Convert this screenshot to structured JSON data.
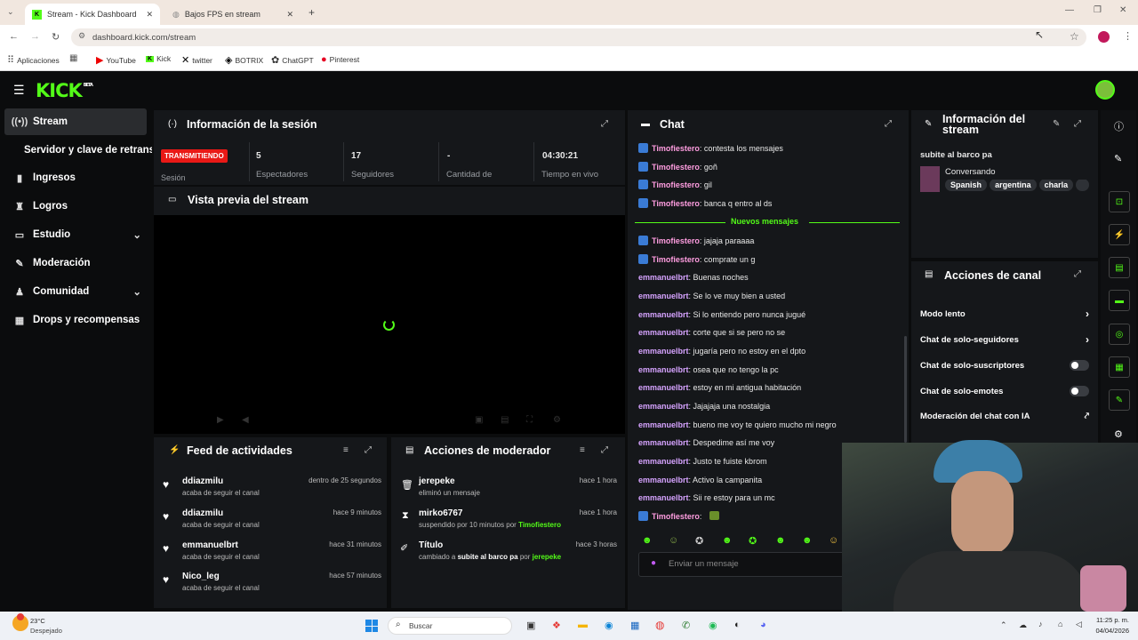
{
  "browser": {
    "tabs": [
      {
        "title": "Stream - Kick Dashboard"
      },
      {
        "title": "Bajos FPS en stream"
      }
    ],
    "url": "dashboard.kick.com/stream",
    "bookmarks": [
      "Aplicaciones",
      "YouTube",
      "Kick",
      "twitter",
      "BOTRIX",
      "ChatGPT",
      "Pinterest"
    ]
  },
  "brand": {
    "logo": "KICK",
    "beta": "BETA",
    "accent": "#53fc18"
  },
  "sidebar": {
    "items": [
      {
        "label": "Stream",
        "icon": "broadcast-icon"
      },
      {
        "label": "Servidor y clave de retransmisión",
        "icon": ""
      },
      {
        "label": "Ingresos",
        "icon": "chart-icon"
      },
      {
        "label": "Logros",
        "icon": "trophy-icon"
      },
      {
        "label": "Estudio",
        "icon": "monitor-icon"
      },
      {
        "label": "Moderación",
        "icon": "wrench-icon"
      },
      {
        "label": "Comunidad",
        "icon": "users-icon"
      },
      {
        "label": "Drops y recompensas",
        "icon": "gift-icon"
      }
    ]
  },
  "session": {
    "title": "Información de la sesión",
    "status": "TRANSMITIENDO",
    "status_label": "Sesión",
    "stats": [
      {
        "value": "5",
        "label": "Espectadores"
      },
      {
        "value": "17",
        "label": "Seguidores"
      },
      {
        "value": "-",
        "label": "Cantidad de"
      },
      {
        "value": "04:30:21",
        "label": "Tiempo en vivo"
      }
    ]
  },
  "preview": {
    "title": "Vista previa del stream"
  },
  "feed": {
    "title": "Feed de actividades",
    "items": [
      {
        "name": "ddiazmilu",
        "action": "acaba de seguir el canal",
        "time": "dentro de 25 segundos"
      },
      {
        "name": "ddiazmilu",
        "action": "acaba de seguir el canal",
        "time": "hace 9 minutos"
      },
      {
        "name": "emmanuelbrt",
        "action": "acaba de seguir el canal",
        "time": "hace 31 minutos"
      },
      {
        "name": "Nico_leg",
        "action": "acaba de seguir el canal",
        "time": "hace 57 minutos"
      }
    ]
  },
  "mod": {
    "title": "Acciones de moderador",
    "items": [
      {
        "name": "jerepeke",
        "action": "eliminó un mensaje",
        "time": "hace 1 hora",
        "icon": "trash-icon"
      },
      {
        "name": "mirko6767",
        "action": "suspendido por 10 minutos por",
        "by": "Timofiestero",
        "time": "hace 1 hora",
        "icon": "hourglass-icon"
      },
      {
        "name": "Título",
        "action": "cambiado a",
        "value": "subite al barco pa",
        "by_prefix": "por",
        "by": "jerepeke",
        "time": "hace 3 horas",
        "icon": "edit-user-icon"
      }
    ]
  },
  "chat": {
    "title": "Chat",
    "new_label": "Nuevos mensajes",
    "messages_before": [
      {
        "user": "Timofiestero",
        "text": "contesta los mensajes"
      },
      {
        "user": "Timofiestero",
        "text": "goñ"
      },
      {
        "user": "Timofiestero",
        "text": "gil"
      },
      {
        "user": "Timofiestero",
        "text": "banca q entro al ds"
      }
    ],
    "messages_after": [
      {
        "user": "Timofiestero",
        "text": "jajaja paraaaa",
        "mod": true
      },
      {
        "user": "Timofiestero",
        "text": "comprate un g",
        "mod": true
      },
      {
        "user": "emmanuelbrt",
        "text": "Buenas noches"
      },
      {
        "user": "emmanuelbrt",
        "text": "Se lo ve muy bien a usted"
      },
      {
        "user": "emmanuelbrt",
        "text": "Si lo entiendo pero nunca jugué"
      },
      {
        "user": "emmanuelbrt",
        "text": "corte que si se pero no se"
      },
      {
        "user": "emmanuelbrt",
        "text": "jugaría pero no estoy en el dpto"
      },
      {
        "user": "emmanuelbrt",
        "text": "osea que no tengo la pc"
      },
      {
        "user": "emmanuelbrt",
        "text": "estoy en mi antigua habitación"
      },
      {
        "user": "emmanuelbrt",
        "text": "Jajajaja una nostalgia"
      },
      {
        "user": "emmanuelbrt",
        "text": "bueno me voy te quiero mucho mi negro"
      },
      {
        "user": "emmanuelbrt",
        "text": "Despedime así me voy"
      },
      {
        "user": "emmanuelbrt",
        "text": "Justo te fuiste kbrom"
      },
      {
        "user": "emmanuelbrt",
        "text": "Activo la campanita"
      },
      {
        "user": "emmanuelbrt",
        "text": "Sii re estoy para un mc"
      },
      {
        "user": "Timofiestero",
        "text": "",
        "mod": true
      }
    ],
    "input_placeholder": "Enviar un mensaje"
  },
  "stream_info": {
    "title": "Información del stream",
    "stream_title": "subite al barco pa",
    "category": "Conversando",
    "tags": [
      "Spanish",
      "argentina",
      "charla"
    ]
  },
  "channel_actions": {
    "title": "Acciones de canal",
    "items": [
      {
        "label": "Modo lento",
        "control": "arrow"
      },
      {
        "label": "Chat de solo-seguidores",
        "control": "arrow"
      },
      {
        "label": "Chat de solo-suscriptores",
        "control": "toggle"
      },
      {
        "label": "Chat de solo-emotes",
        "control": "toggle"
      },
      {
        "label": "Moderación del chat con IA",
        "control": "external"
      }
    ]
  },
  "taskbar": {
    "weather_temp": "23°C",
    "weather_desc": "Despejado",
    "search": "Buscar",
    "time": "11:25 p. m.",
    "date": "04/04/2026"
  }
}
